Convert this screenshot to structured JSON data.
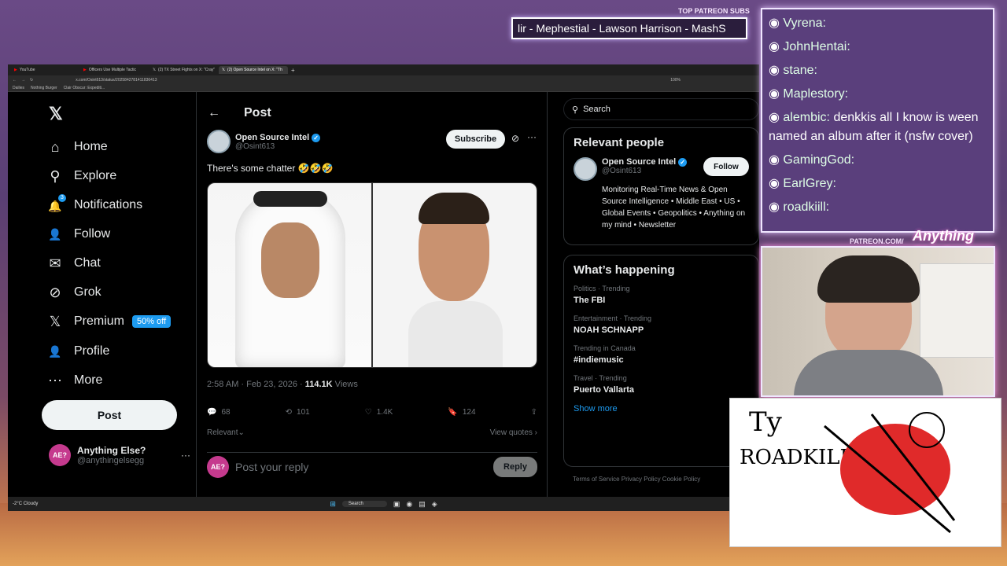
{
  "overlay": {
    "top_patreon_label": "TOP PATREON SUBS",
    "ticker_text": "lir - Mephestial - Lawson Harrison - MashS",
    "patreon_url": "PATREON.COM/",
    "brand_script": "Anything Else?"
  },
  "browser": {
    "tabs": [
      {
        "label": "YouTube"
      },
      {
        "label": "Officers Use Multiple Tactic"
      },
      {
        "label": "(2) TX Street Fights on X: \"Cray\""
      },
      {
        "label": "(2) Open Source Intel on X: \"Th"
      }
    ],
    "url": "x.com/Osint613/status/2025842781411836413",
    "zoom": "100%",
    "bookmarks": [
      "Dailies",
      "Nothing Burger",
      "Clair Obscur: Expediti..."
    ]
  },
  "x_nav": {
    "items": [
      {
        "label": "Home",
        "icon": "home-icon",
        "glyph": "⌂"
      },
      {
        "label": "Explore",
        "icon": "search-icon",
        "glyph": "⚲"
      },
      {
        "label": "Notifications",
        "icon": "bell-icon",
        "glyph": "🔔"
      },
      {
        "label": "Follow",
        "icon": "person-add-icon",
        "glyph": "👤"
      },
      {
        "label": "Chat",
        "icon": "mail-icon",
        "glyph": "✉"
      },
      {
        "label": "Grok",
        "icon": "grok-icon",
        "glyph": "⊘"
      },
      {
        "label": "Premium",
        "icon": "x-premium-icon",
        "glyph": "𝕏"
      },
      {
        "label": "Profile",
        "icon": "profile-icon",
        "glyph": "👤"
      },
      {
        "label": "More",
        "icon": "more-circle-icon",
        "glyph": "⋯"
      }
    ],
    "notifications_badge": "3",
    "premium_badge": "50% off",
    "post_button": "Post",
    "account_name": "Anything Else?",
    "account_handle": "@anythingelsegg",
    "avatar_text": "AE?"
  },
  "post": {
    "header": "Post",
    "author_name": "Open Source Intel",
    "author_handle": "@Osint613",
    "subscribe": "Subscribe",
    "text": "There's some chatter 🤣🤣🤣",
    "time": "2:58 AM · Feb 23, 2026 · ",
    "views_count": "114.1K",
    "views_label": " Views",
    "replies": "68",
    "reposts": "101",
    "likes": "1.4K",
    "bookmarks": "124",
    "relevant": "Relevant",
    "view_quotes": "View quotes",
    "reply_placeholder": "Post your reply",
    "reply_button": "Reply"
  },
  "sidebar": {
    "search_placeholder": "Search",
    "relevant_title": "Relevant people",
    "person_name": "Open Source Intel",
    "person_handle": "@Osint613",
    "follow": "Follow",
    "person_bio": "Monitoring Real-Time News & Open Source Intelligence • Middle East • US • Global Events • Geopolitics • Anything on my mind • Newsletter",
    "happening_title": "What’s happening",
    "trends": [
      {
        "meta": "Politics · Trending",
        "name": "The FBI"
      },
      {
        "meta": "Entertainment · Trending",
        "name": "NOAH SCHNAPP"
      },
      {
        "meta": "Trending in Canada",
        "name": "#indiemusic"
      },
      {
        "meta": "Travel · Trending",
        "name": "Puerto Vallarta"
      }
    ],
    "show_more": "Show more",
    "footer": "Terms of Service   Privacy Policy   Cookie Policy"
  },
  "taskbar": {
    "weather_temp": "-2°C",
    "weather_desc": "Cloudy",
    "search": "Search"
  },
  "chat": [
    {
      "user": "Vyrena:",
      "msg": "",
      "color": "#ffffff"
    },
    {
      "user": "JohnHentai:",
      "msg": "",
      "color": "#ffffff"
    },
    {
      "user": "stane:",
      "msg": "",
      "color": "#ffffff"
    },
    {
      "user": "Maplestory:",
      "msg": "",
      "color": "#ffffff"
    },
    {
      "user": "alembic:",
      "msg": "denkkis all I know is ween named an album after it (nsfw cover)",
      "color": "#ffffff"
    },
    {
      "user": "GamingGod:",
      "msg": "",
      "color": "#ffffff"
    },
    {
      "user": "EarlGrey:",
      "msg": "",
      "color": "#ffffff"
    },
    {
      "user": "roadkiill:",
      "msg": "",
      "color": "#ffffff"
    }
  ],
  "drawing": {
    "text_line1": "Ty",
    "text_line2": "ROADKILL"
  }
}
